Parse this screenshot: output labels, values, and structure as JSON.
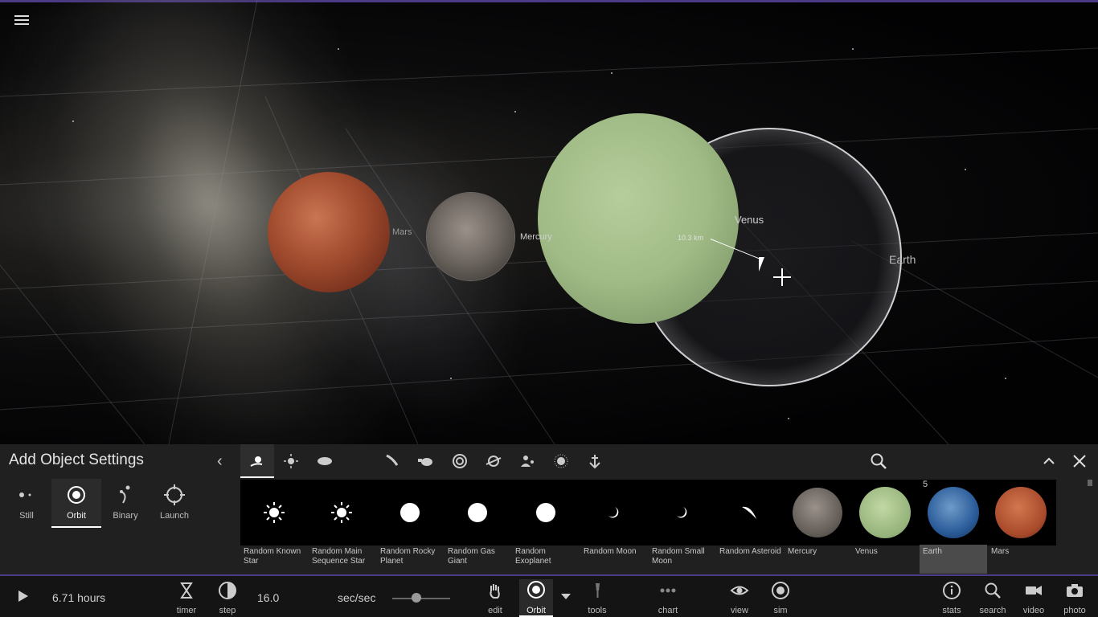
{
  "viewport": {
    "labels": {
      "mars": "Mars",
      "mercury": "Mercury",
      "venus": "Venus",
      "earth": "Earth",
      "distance": "10.3 km"
    }
  },
  "panel": {
    "title": "Add Object Settings",
    "modes": [
      {
        "label": "Still",
        "icon": "still-icon"
      },
      {
        "label": "Orbit",
        "icon": "orbit-icon",
        "active": true
      },
      {
        "label": "Binary",
        "icon": "binary-icon"
      },
      {
        "label": "Launch",
        "icon": "launch-icon"
      }
    ],
    "categories": [
      "star-system-icon",
      "star-icon",
      "planet-icon",
      "moon-icon",
      "comet-icon",
      "spacecraft-icon",
      "galaxy-icon",
      "ring-icon",
      "people-icon",
      "particle-icon",
      "anchor-icon"
    ],
    "items": [
      {
        "name": "Random Known Star",
        "thumb": "star"
      },
      {
        "name": "Random Main Sequence Star",
        "thumb": "star"
      },
      {
        "name": "Random Rocky Planet",
        "thumb": "disc"
      },
      {
        "name": "Random Gas Giant",
        "thumb": "disc"
      },
      {
        "name": "Random Exoplanet",
        "thumb": "disc"
      },
      {
        "name": "Random Moon",
        "thumb": "crescent"
      },
      {
        "name": "Random Small Moon",
        "thumb": "crescent"
      },
      {
        "name": "Random Asteroid",
        "thumb": "asteroid"
      },
      {
        "name": "Mercury",
        "thumb": "mercury"
      },
      {
        "name": "Venus",
        "thumb": "venus"
      },
      {
        "name": "Earth",
        "thumb": "earth",
        "selected": true
      },
      {
        "name": "Mars",
        "thumb": "mars"
      }
    ],
    "earth_count": "5"
  },
  "bottombar": {
    "time": "6.71 hours",
    "rate": "16.0",
    "rate_unit": "sec/sec",
    "slider_level": 0.42,
    "buttons": {
      "timer": "timer",
      "step": "step",
      "edit": "edit",
      "orbit": "Orbit",
      "tools": "tools",
      "chart": "chart",
      "view": "view",
      "sim": "sim",
      "stats": "stats",
      "search": "search",
      "video": "video",
      "photo": "photo"
    }
  },
  "colors": {
    "accent": "#4b3a86",
    "panel_bg": "#202020",
    "bar_bg": "#141414"
  }
}
